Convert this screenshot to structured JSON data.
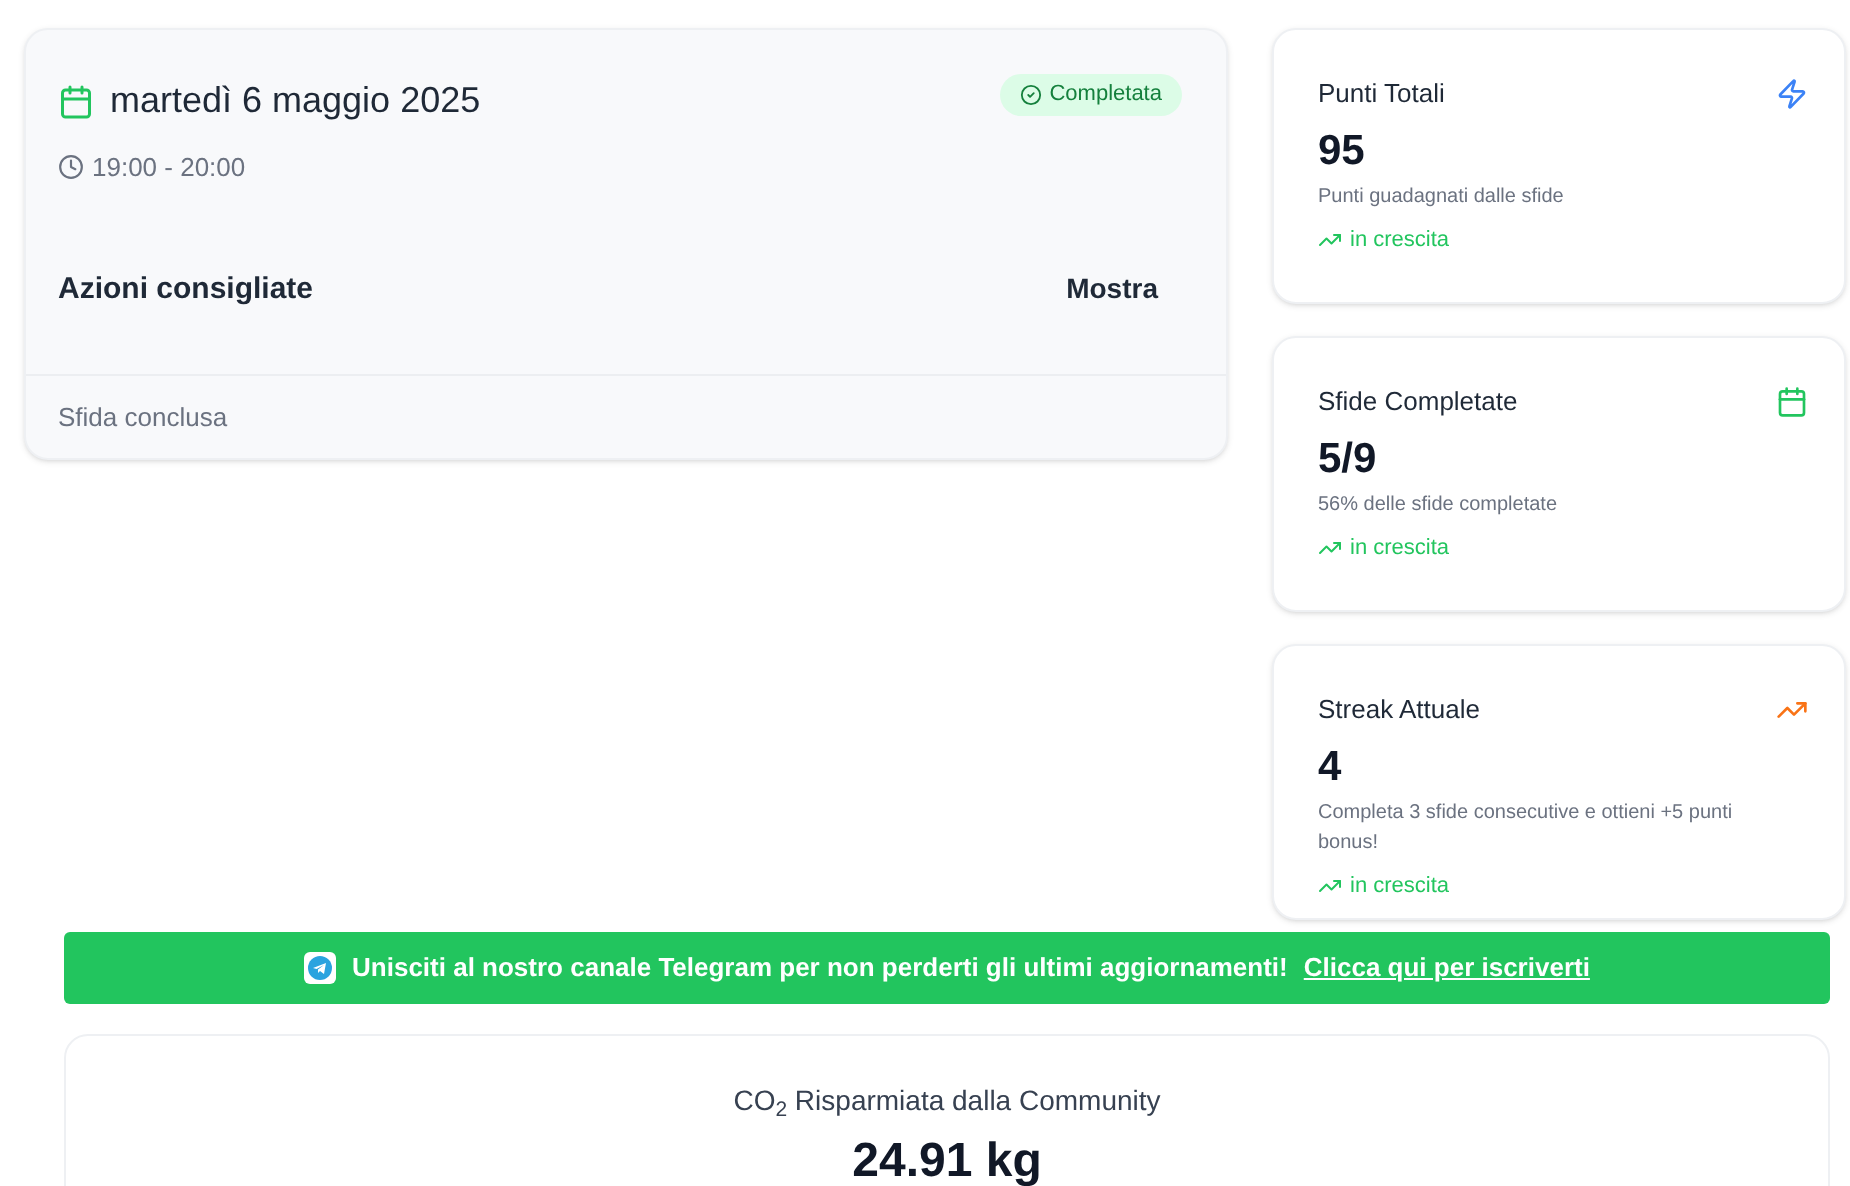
{
  "challenge": {
    "date": "martedì 6 maggio 2025",
    "time": "19:00 - 20:00",
    "status": {
      "label": "Completata",
      "kind": "completed"
    },
    "actions": {
      "label": "Azioni consigliate",
      "toggle": "Mostra"
    },
    "footer": "Sfida conclusa"
  },
  "stats": [
    {
      "title": "Punti Totali",
      "kind": "zap",
      "color": "#3b82f6",
      "value": "95",
      "description": "Punti guadagnati dalle sfide",
      "trend": "in crescita"
    },
    {
      "title": "Sfide Completate",
      "kind": "calendar",
      "color": "#22c55e",
      "value": "5/9",
      "description": "56% delle sfide completate",
      "trend": "in crescita"
    },
    {
      "title": "Streak Attuale",
      "kind": "trend",
      "color": "#f97316",
      "value": "4",
      "description": "Completa 3 sfide consecutive e ottieni +5 punti bonus!",
      "trend": "in crescita"
    }
  ],
  "banner": {
    "text": "Unisciti al nostro canale Telegram per non perderti gli ultimi aggiornamenti!",
    "link": "Clicca qui per iscriverti"
  },
  "co2": {
    "title": "CO$_{2}$ Risparmiata dalla Community",
    "value": "24.91 kg"
  }
}
